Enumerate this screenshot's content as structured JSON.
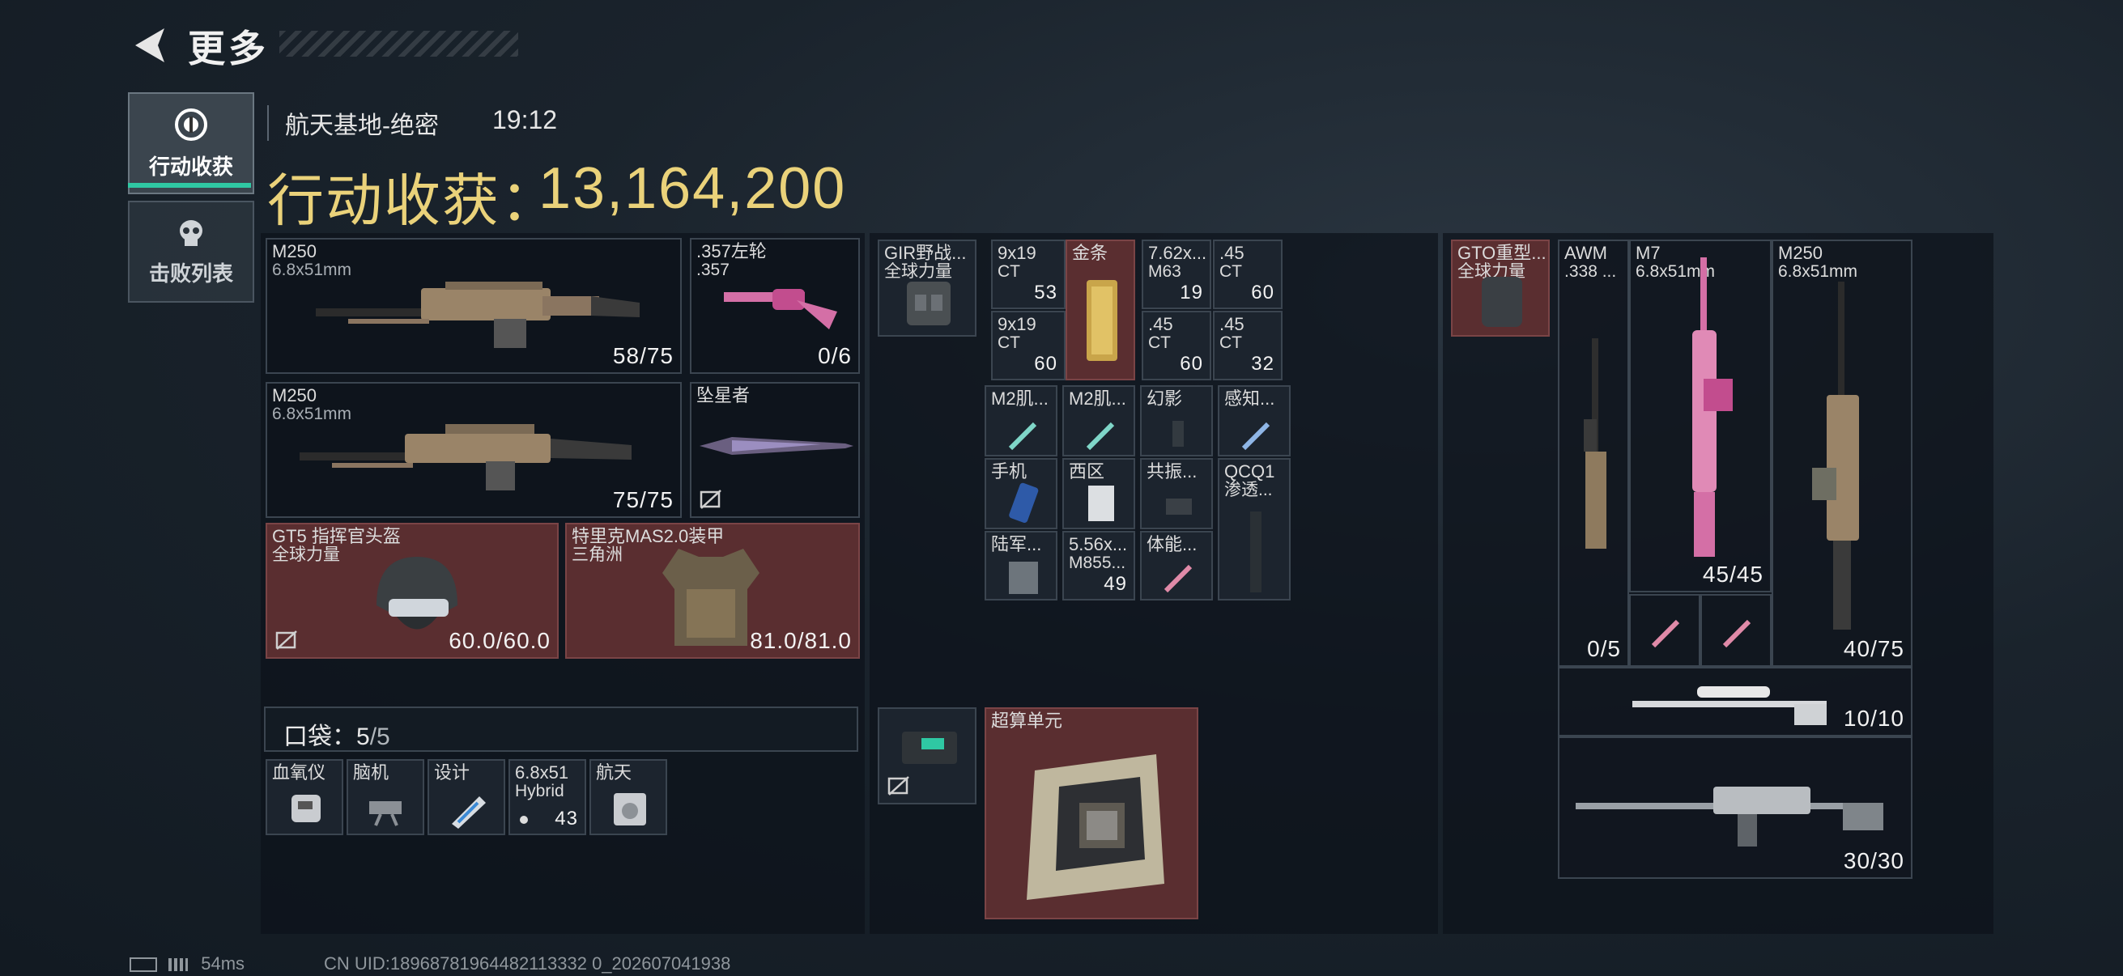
{
  "header": {
    "title": "更多"
  },
  "tabs": [
    {
      "label": "行动收获",
      "icon": "loot-icon",
      "active": true
    },
    {
      "label": "击败列表",
      "icon": "skull-icon",
      "active": false
    }
  ],
  "match": {
    "map": "航天基地-绝密",
    "time": "19:12"
  },
  "loot": {
    "label": "行动收获：",
    "value": "13,164,200"
  },
  "equipment": {
    "primary_1": {
      "name": "M250",
      "ammo": "6.8x51mm",
      "count": "58/75"
    },
    "pistol": {
      "name": ".357左轮",
      "ammo": ".357",
      "count": "0/6"
    },
    "primary_2": {
      "name": "M250",
      "ammo": "6.8x51mm",
      "count": "75/75"
    },
    "melee": {
      "name": "坠星者"
    },
    "helmet": {
      "name": "GT5 指挥官头盔",
      "faction": "全球力量",
      "durability": "60.0/60.0"
    },
    "armor": {
      "name": "特里克MAS2.0装甲",
      "faction": "三角洲",
      "durability": "81.0/81.0"
    }
  },
  "pocket": {
    "label": "口袋：",
    "used": "5",
    "sep": "/",
    "capacity": "5",
    "items": [
      {
        "name": "血氧仪"
      },
      {
        "name": "脑机"
      },
      {
        "name": "设计"
      },
      {
        "name": "6.8x51",
        "sub": "Hybrid",
        "count": "43"
      },
      {
        "name": "航天"
      }
    ]
  },
  "chest_rig": {
    "name": "GIR野战...",
    "faction": "全球力量"
  },
  "rig_items": [
    {
      "name": "9x19",
      "sub": "CT",
      "count": "53"
    },
    {
      "name": "金条"
    },
    {
      "name": "7.62x...",
      "sub": "M63",
      "count": "19"
    },
    {
      "name": ".45",
      "sub": "CT",
      "count": "60"
    },
    {
      "name": "9x19",
      "sub": "CT",
      "count": "60"
    },
    {
      "name": ".45",
      "sub": "CT",
      "count": "60"
    },
    {
      "name": ".45",
      "sub": "CT",
      "count": "32"
    }
  ],
  "backpack_items": [
    {
      "name": "M2肌..."
    },
    {
      "name": "M2肌..."
    },
    {
      "name": "幻影"
    },
    {
      "name": "感知..."
    },
    {
      "name": "手机"
    },
    {
      "name": "西区"
    },
    {
      "name": "共振..."
    },
    {
      "name": "QCQ1",
      "sub": "渗透..."
    },
    {
      "name": "陆军..."
    },
    {
      "name": "5.56x...",
      "sub": "M855...",
      "count": "49"
    },
    {
      "name": "体能..."
    }
  ],
  "secure_case": {},
  "special": {
    "name": "超算单元"
  },
  "backpack": {
    "name": "GTO重型...",
    "faction": "全球力量"
  },
  "stash": {
    "awm": {
      "name": "AWM",
      "sub": ".338 ...",
      "count": "0/5"
    },
    "m7": {
      "name": "M7",
      "sub": "6.8x51mm",
      "count": "45/45"
    },
    "m250": {
      "name": "M250",
      "sub": "6.8x51mm",
      "count": "40/75"
    },
    "sniper": {
      "count": "10/10"
    },
    "rifle": {
      "count": "30/30"
    }
  },
  "footer": {
    "ping": "54ms",
    "uid": "CN UID:18968781964482113332 0_202607041938"
  },
  "colors": {
    "accent": "#2fc8a3",
    "gold": "#ead27a",
    "red_slot": "#5a2e30"
  }
}
